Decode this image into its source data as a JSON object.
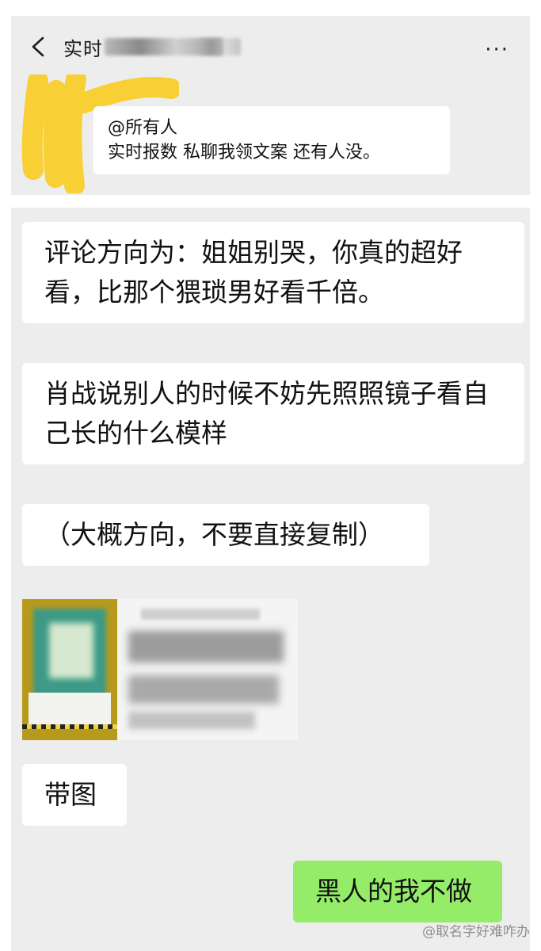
{
  "header": {
    "title": "实时",
    "back_icon": "chevron-left-icon",
    "more_icon": "more-dots-icon",
    "more_glyph": "···"
  },
  "top_message": {
    "mention": "@所有人",
    "text": "实时报数 私聊我领文案 还有人没。"
  },
  "messages": {
    "m1": "评论方向为：姐姐别哭，你真的超好看，比那个猥琐男好看千倍。",
    "m2": "肖战说别人的时候不妨先照照镜子看自己长的什么模样",
    "m3": "（大概方向，不要直接复制）",
    "m4": "带图",
    "reply": "黑人的我不做"
  },
  "watermark": "@取名字好难咋办",
  "colors": {
    "chat_bg": "#ededed",
    "bubble": "#ffffff",
    "sent_bubble": "#95ec69",
    "highlighter": "#f9cd2a"
  }
}
